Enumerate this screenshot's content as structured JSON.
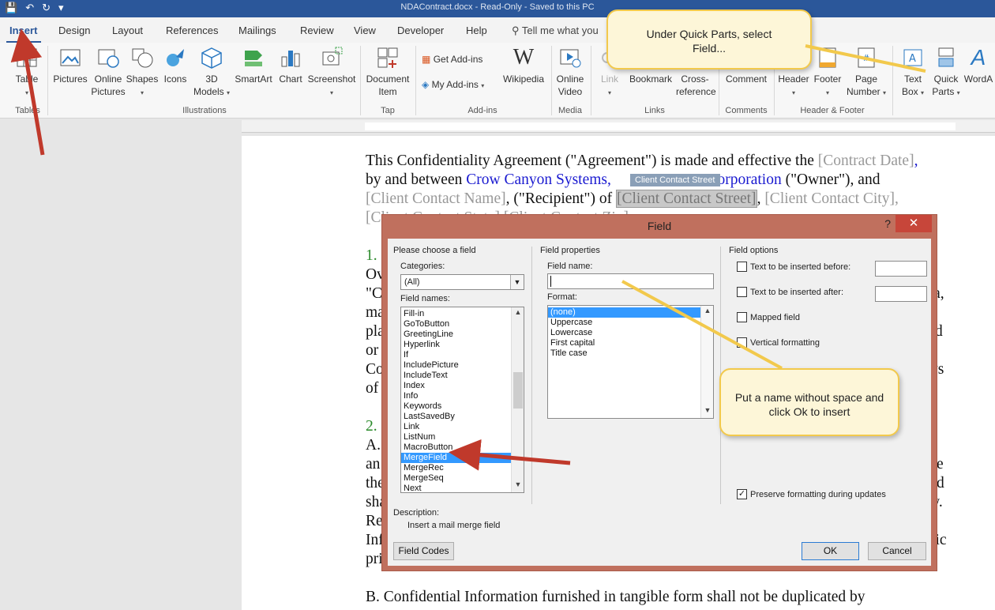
{
  "titlebar": {
    "title": "NDAContract.docx - Read-Only - Saved to this PC"
  },
  "tabs": [
    {
      "label": "Insert"
    },
    {
      "label": "Design"
    },
    {
      "label": "Layout"
    },
    {
      "label": "References"
    },
    {
      "label": "Mailings"
    },
    {
      "label": "Review"
    },
    {
      "label": "View"
    },
    {
      "label": "Developer"
    },
    {
      "label": "Help"
    }
  ],
  "tell_me": "Tell me what you",
  "ribbon": {
    "table": "Table",
    "pictures": "Pictures",
    "online_pictures_1": "Online",
    "online_pictures_2": "Pictures",
    "shapes": "Shapes",
    "icons": "Icons",
    "models_1": "3D",
    "models_2": "Models",
    "smartart": "SmartArt",
    "chart": "Chart",
    "screenshot": "Screenshot",
    "document_item_1": "Document",
    "document_item_2": "Item",
    "get_addins": "Get Add-ins",
    "my_addins": "My Add-ins",
    "wikipedia": "Wikipedia",
    "online_video_1": "Online",
    "online_video_2": "Video",
    "link": "Link",
    "bookmark": "Bookmark",
    "cross_ref_1": "Cross-",
    "cross_ref_2": "reference",
    "comment": "Comment",
    "header": "Header",
    "footer": "Footer",
    "page_number_1": "Page",
    "page_number_2": "Number",
    "text_box_1": "Text",
    "text_box_2": "Box",
    "quick_parts_1": "Quick",
    "quick_parts_2": "Parts",
    "wordart": "WordA",
    "groups": {
      "tables": "Tables",
      "illustrations": "Illustrations",
      "tap": "Tap",
      "addins": "Add-ins",
      "media": "Media",
      "links": "Links",
      "comments": "Comments",
      "header_footer": "Header & Footer"
    }
  },
  "document": {
    "l1a": "This Confidentiality Agreement (\"Agreement\") is made and effective the ",
    "l1b": "[Contract Date]",
    "l1c": ",",
    "l2a": "by and between ",
    "l2b": "Crow Canyon Systems, ",
    "l2c": "nia Corporation",
    "l2d": " (\"Owner\"), and",
    "cc_tag": "Client Contact Street",
    "l3a": "[Client Contact Name]",
    "l3b": ", (\"Recipient\") of ",
    "l3c": "[Client Contact Street]",
    "l3d": ", ",
    "l3e": "[Client Contact City]",
    "l3f": ",",
    "l4a": "[Client Contact State] [Client Contact Zip]",
    "n1": "1.",
    "f1": "Ov",
    "f2": "\"C",
    "f3": "ma",
    "f4": "pla",
    "f5": "or",
    "f6": "Co",
    "f7": "of",
    "r1": "ata,",
    "r2": "d",
    "r3": "ys",
    "n2": "2.",
    "g1": "A.",
    "g2": "an",
    "g3": "the",
    "g4": "sha",
    "g5": "Re",
    "g6": "Inf",
    "g7": "pri",
    "s1": "e",
    "s2": "d",
    "s3": "w.",
    "s4": "fic",
    "lb": "B.  Confidential Information furnished in tangible form shall not be duplicated by"
  },
  "dialog": {
    "title": "Field",
    "help": "?",
    "close": "✕",
    "choose": "Please choose a field",
    "categories_label": "Categories:",
    "categories_value": "(All)",
    "field_names_label": "Field names:",
    "field_names": [
      "Fill-in",
      "GoToButton",
      "GreetingLine",
      "Hyperlink",
      "If",
      "IncludePicture",
      "IncludeText",
      "Index",
      "Info",
      "Keywords",
      "LastSavedBy",
      "Link",
      "ListNum",
      "MacroButton",
      "MergeField",
      "MergeRec",
      "MergeSeq",
      "Next"
    ],
    "selected_field": "MergeField",
    "field_props": "Field properties",
    "field_name_label": "Field name:",
    "field_name_value": "",
    "format_label": "Format:",
    "formats": [
      "(none)",
      "Uppercase",
      "Lowercase",
      "First capital",
      "Title case"
    ],
    "field_options": "Field options",
    "opt_before": "Text to be inserted before:",
    "opt_after": "Text to be inserted after:",
    "opt_mapped": "Mapped field",
    "opt_vertical": "Vertical formatting",
    "preserve": "Preserve formatting during updates",
    "description_label": "Description:",
    "description": "Insert a mail merge field",
    "field_codes": "Field Codes",
    "ok": "OK",
    "cancel": "Cancel"
  },
  "callouts": {
    "quick_parts": "Under Quick Parts, select Field...",
    "field_name": "Put a name without space and click Ok to insert"
  },
  "colors": {
    "word_blue": "#2b579a",
    "dialog_border": "#c0705e",
    "close_red": "#c7463a",
    "arrow_red": "#c0392b",
    "callout_bg": "#fdf6d8",
    "callout_border": "#f2c94c"
  }
}
